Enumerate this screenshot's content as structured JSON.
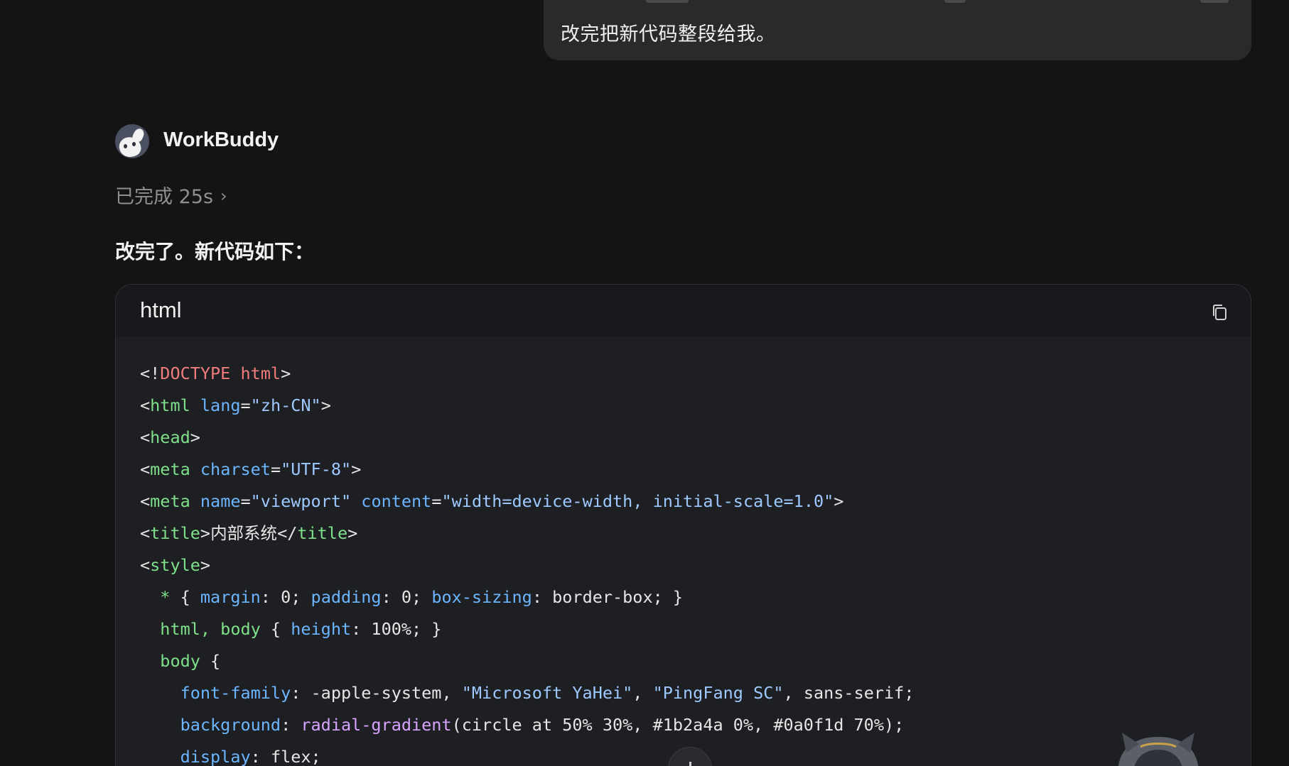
{
  "user_message": {
    "text": "改完把新代码整段给我。"
  },
  "assistant": {
    "name": "WorkBuddy",
    "status": "已完成 25s",
    "reply": "改完了。新代码如下："
  },
  "code_block": {
    "language": "html",
    "lines": [
      [
        [
          "t-punc",
          "<!"
        ],
        [
          "t-doc",
          "DOCTYPE html"
        ],
        [
          "t-punc",
          ">"
        ]
      ],
      [
        [
          "t-punc",
          "<"
        ],
        [
          "t-tag",
          "html"
        ],
        [
          "t-punc",
          " "
        ],
        [
          "t-attr",
          "lang"
        ],
        [
          "t-punc",
          "="
        ],
        [
          "t-str",
          "\"zh-CN\""
        ],
        [
          "t-punc",
          ">"
        ]
      ],
      [
        [
          "t-punc",
          "<"
        ],
        [
          "t-tag",
          "head"
        ],
        [
          "t-punc",
          ">"
        ]
      ],
      [
        [
          "t-punc",
          "<"
        ],
        [
          "t-tag",
          "meta"
        ],
        [
          "t-punc",
          " "
        ],
        [
          "t-attr",
          "charset"
        ],
        [
          "t-punc",
          "="
        ],
        [
          "t-str",
          "\"UTF-8\""
        ],
        [
          "t-punc",
          ">"
        ]
      ],
      [
        [
          "t-punc",
          "<"
        ],
        [
          "t-tag",
          "meta"
        ],
        [
          "t-punc",
          " "
        ],
        [
          "t-attr",
          "name"
        ],
        [
          "t-punc",
          "="
        ],
        [
          "t-str",
          "\"viewport\""
        ],
        [
          "t-punc",
          " "
        ],
        [
          "t-attr",
          "content"
        ],
        [
          "t-punc",
          "="
        ],
        [
          "t-str",
          "\"width=device-width, initial-scale=1.0\""
        ],
        [
          "t-punc",
          ">"
        ]
      ],
      [
        [
          "t-punc",
          "<"
        ],
        [
          "t-tag",
          "title"
        ],
        [
          "t-punc",
          ">"
        ],
        [
          "t-text",
          "内部系统"
        ],
        [
          "t-punc",
          "</"
        ],
        [
          "t-tag",
          "title"
        ],
        [
          "t-punc",
          ">"
        ]
      ],
      [
        [
          "t-punc",
          "<"
        ],
        [
          "t-tag",
          "style"
        ],
        [
          "t-punc",
          ">"
        ]
      ],
      [
        [
          "t-punc",
          "  "
        ],
        [
          "t-sel",
          "*"
        ],
        [
          "t-punc",
          " { "
        ],
        [
          "t-prop",
          "margin"
        ],
        [
          "t-punc",
          ": "
        ],
        [
          "t-val",
          "0"
        ],
        [
          "t-punc",
          "; "
        ],
        [
          "t-prop",
          "padding"
        ],
        [
          "t-punc",
          ": "
        ],
        [
          "t-val",
          "0"
        ],
        [
          "t-punc",
          "; "
        ],
        [
          "t-prop",
          "box-sizing"
        ],
        [
          "t-punc",
          ": "
        ],
        [
          "t-val",
          "border-box"
        ],
        [
          "t-punc",
          "; }"
        ]
      ],
      [
        [
          "t-punc",
          "  "
        ],
        [
          "t-sel",
          "html, body"
        ],
        [
          "t-punc",
          " { "
        ],
        [
          "t-prop",
          "height"
        ],
        [
          "t-punc",
          ": "
        ],
        [
          "t-val",
          "100%"
        ],
        [
          "t-punc",
          "; }"
        ]
      ],
      [
        [
          "t-punc",
          "  "
        ],
        [
          "t-sel",
          "body"
        ],
        [
          "t-punc",
          " {"
        ]
      ],
      [
        [
          "t-punc",
          "    "
        ],
        [
          "t-prop",
          "font-family"
        ],
        [
          "t-punc",
          ": "
        ],
        [
          "t-val",
          "-apple-system, "
        ],
        [
          "t-str",
          "\"Microsoft YaHei\""
        ],
        [
          "t-val",
          ", "
        ],
        [
          "t-str",
          "\"PingFang SC\""
        ],
        [
          "t-val",
          ", sans-serif"
        ],
        [
          "t-punc",
          ";"
        ]
      ],
      [
        [
          "t-punc",
          "    "
        ],
        [
          "t-prop",
          "background"
        ],
        [
          "t-punc",
          ": "
        ],
        [
          "t-fn",
          "radial-gradient"
        ],
        [
          "t-val",
          "(circle at 50% 30%, #1b2a4a 0%, #0a0f1d 70%)"
        ],
        [
          "t-punc",
          ";"
        ]
      ],
      [
        [
          "t-punc",
          "    "
        ],
        [
          "t-prop",
          "display"
        ],
        [
          "t-punc",
          ": "
        ],
        [
          "t-val",
          "flex"
        ],
        [
          "t-punc",
          ";"
        ]
      ]
    ]
  },
  "colors": {
    "background": "#141414",
    "bubble": "#2a2a2a",
    "code_bg": "#1e1f23",
    "code_header_bg": "#18191c",
    "tag": "#7fe08a",
    "attr": "#6cb6ff",
    "doctype": "#f07c7c",
    "function": "#d7a3ff"
  },
  "icons": {
    "copy": "copy-icon",
    "status_chevron": "chevron-right-icon",
    "scroll": "arrow-down-icon"
  }
}
